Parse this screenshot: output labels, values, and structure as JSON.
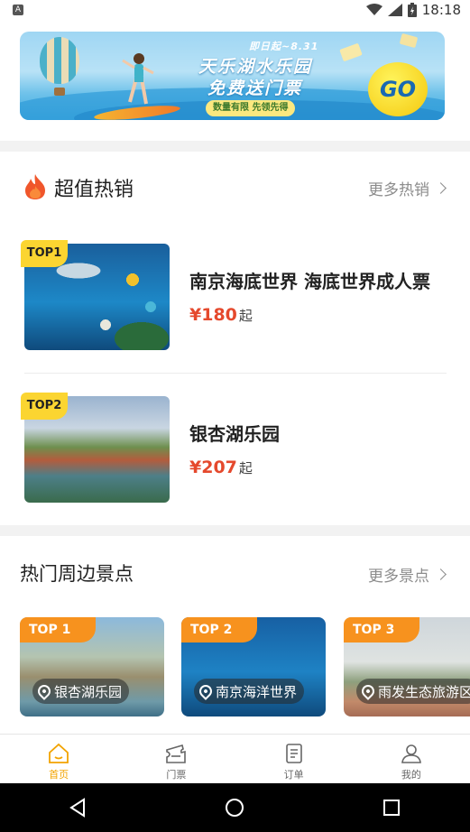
{
  "status_bar": {
    "time": "18:18",
    "notification_letter": "A"
  },
  "banner": {
    "date_line": "即日起~8.31",
    "title_line1": "天乐湖水乐园",
    "title_line2": "免费送门票",
    "subtitle": "数量有限 先领先得",
    "cta": "GO"
  },
  "hot_sales": {
    "title": "超值热销",
    "more_label": "更多热销",
    "products": [
      {
        "badge": "TOP1",
        "name": "南京海底世界 海底世界成人票",
        "price": "¥180",
        "price_suffix": "起"
      },
      {
        "badge": "TOP2",
        "name": "银杏湖乐园",
        "price": "¥207",
        "price_suffix": "起"
      }
    ]
  },
  "nearby": {
    "title": "热门周边景点",
    "more_label": "更多景点",
    "spots": [
      {
        "badge": "TOP 1",
        "name": "银杏湖乐园"
      },
      {
        "badge": "TOP 2",
        "name": "南京海洋世界"
      },
      {
        "badge": "TOP 3",
        "name": "雨发生态旅游区"
      }
    ]
  },
  "tabbar": {
    "items": [
      {
        "label": "首页",
        "icon": "home-icon",
        "active": true
      },
      {
        "label": "门票",
        "icon": "ticket-icon",
        "active": false
      },
      {
        "label": "订单",
        "icon": "order-icon",
        "active": false
      },
      {
        "label": "我的",
        "icon": "profile-icon",
        "active": false
      }
    ]
  },
  "colors": {
    "accent": "#f2a300",
    "price": "#e5492d",
    "badge_yellow": "#fbd531",
    "badge_orange": "#f7921e"
  }
}
